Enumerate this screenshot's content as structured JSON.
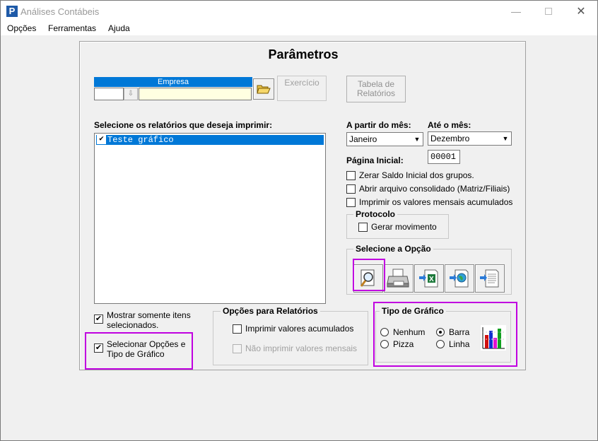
{
  "window": {
    "title": "Análises Contábeis",
    "app_icon": "P"
  },
  "menu": {
    "items": [
      "Opções",
      "Ferramentas",
      "Ajuda"
    ]
  },
  "panel": {
    "title": "Parâmetros",
    "empresa": {
      "header": "Empresa",
      "code": "",
      "name": ""
    },
    "exercicio_label": "Exercício",
    "tabela_label": [
      "Tabela de",
      "Relatórios"
    ],
    "reports_label": "Selecione os relatórios que deseja imprimir:",
    "reports": [
      {
        "label": "Teste gráfico",
        "checked": true,
        "selected": true
      }
    ],
    "from_month_label": "A partir do mês:",
    "from_month": "Janeiro",
    "to_month_label": "Até o mês:",
    "to_month": "Dezembro",
    "page_label": "Página Inicial:",
    "page_value": "00001",
    "options": [
      {
        "label": "Zerar Saldo Inicial dos grupos.",
        "checked": false
      },
      {
        "label": "Abrir arquivo consolidado (Matriz/Filiais)",
        "checked": false
      },
      {
        "label": "Imprimir os valores mensais acumulados",
        "checked": false
      }
    ],
    "protocolo": {
      "title": "Protocolo",
      "gerar_label": "Gerar movimento",
      "checked": false
    },
    "selecione_opcao": {
      "title": "Selecione a Opção",
      "icons": [
        "preview-icon",
        "printer-icon",
        "excel-export-icon",
        "web-export-icon",
        "text-export-icon"
      ]
    },
    "mostrar_label": "Mostrar somente itens selecionados.",
    "mostrar_checked": true,
    "selecionar_label": "Selecionar Opções e Tipo de Gráfico",
    "selecionar_checked": true,
    "opcoes_relatorios": {
      "title": "Opções para Relatórios",
      "imprimir_acumulados": "Imprimir valores acumulados",
      "nao_imprimir_mensais": "Não imprimir valores mensais"
    },
    "tipo_grafico": {
      "title": "Tipo de Gráfico",
      "options": [
        "Nenhum",
        "Barra",
        "Pizza",
        "Linha"
      ],
      "selected": "Barra"
    }
  },
  "colors": {
    "highlight": "#c000e0",
    "selection": "#0078d7",
    "empresa_field": "#ffffe1"
  }
}
